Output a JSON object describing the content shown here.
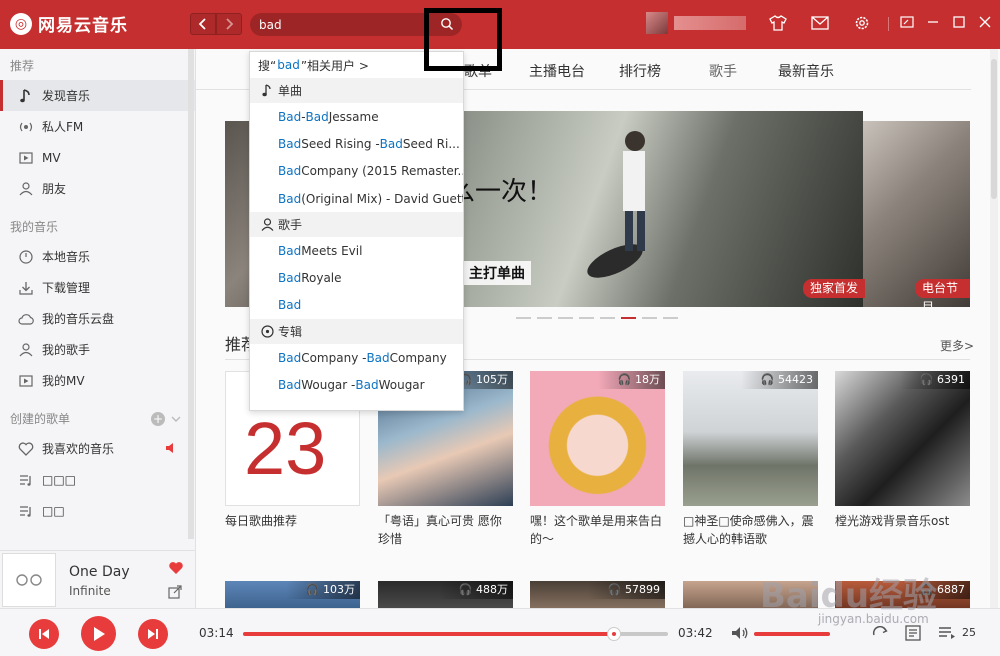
{
  "app": {
    "logo_text": "网易云音乐",
    "accent": "#c62f2f",
    "link_color": "#0c73c2"
  },
  "titlebar": {
    "search_value": "bad",
    "back_icon": "chevron-left-icon",
    "forward_icon": "chevron-right-icon"
  },
  "sidebar": {
    "group_recommend": "推荐",
    "recommend_items": [
      {
        "label": "发现音乐",
        "icon": "music-note-icon"
      },
      {
        "label": "私人FM",
        "icon": "radio-icon"
      },
      {
        "label": "MV",
        "icon": "video-icon"
      },
      {
        "label": "朋友",
        "icon": "friends-icon"
      }
    ],
    "group_my_music": "我的音乐",
    "my_music_items": [
      {
        "label": "本地音乐",
        "icon": "local-music-icon"
      },
      {
        "label": "下载管理",
        "icon": "download-icon"
      },
      {
        "label": "我的音乐云盘",
        "icon": "cloud-icon"
      },
      {
        "label": "我的歌手",
        "icon": "singer-icon"
      },
      {
        "label": "我的MV",
        "icon": "video-icon"
      }
    ],
    "group_playlists": "创建的歌单",
    "playlist_items": [
      {
        "label": "我喜欢的音乐",
        "icon": "heart-icon"
      },
      {
        "label": "□□□",
        "icon": "playlist-icon"
      },
      {
        "label": "□□",
        "icon": "playlist-icon"
      }
    ]
  },
  "now_playing": {
    "title": "One Day",
    "artist": "Infinite"
  },
  "tabs": [
    {
      "label": "歌单"
    },
    {
      "label": "主播电台"
    },
    {
      "label": "排行榜"
    },
    {
      "label": "歌手"
    },
    {
      "label": "最新音乐"
    }
  ],
  "banner": {
    "text_main": "么一次！",
    "text_sub": "主打单曲",
    "tag_exclusive": "独家首发",
    "tag_radio": "电台节目",
    "dots_total": 8,
    "dots_active_index": 5
  },
  "recommend": {
    "title": "推荐",
    "more": "更多>",
    "cards": [
      {
        "title": "每日歌曲推荐",
        "count": "",
        "daily_number": "23"
      },
      {
        "title": "「粤语」真心可贵 愿你珍惜",
        "count": "105万"
      },
      {
        "title": "嘿！这个歌单是用来告白的～",
        "count": "18万"
      },
      {
        "title": "□神圣□使命感佛入，震撼人心的韩语歌",
        "count": "54423"
      },
      {
        "title": "樘光游戏背景音乐ost",
        "count": "6391"
      }
    ],
    "second_row_counts": [
      "103万",
      "488万",
      "57899",
      "",
      "6887"
    ]
  },
  "dropdown": {
    "user_prefix": "搜“",
    "user_keyword": "bad",
    "user_suffix": "”相关用户 >",
    "cat_songs": "单曲",
    "songs": [
      {
        "kw1": "Bad",
        "sep": " - ",
        "kw2": "Bad",
        "rest": " Jessame"
      },
      {
        "kw1": "Bad",
        "sep": " Seed Rising - ",
        "kw2": "Bad",
        "rest": " Seed Ri..."
      },
      {
        "kw1": "Bad",
        "sep": " Company (2015 Remaster...",
        "kw2": "",
        "rest": ""
      },
      {
        "kw1": "Bad",
        "sep": " (Original Mix) - David Guetta...",
        "kw2": "",
        "rest": ""
      }
    ],
    "cat_artists": "歌手",
    "artists": [
      {
        "kw1": "Bad",
        "rest": " Meets Evil"
      },
      {
        "kw1": "Bad",
        "rest": " Royale"
      },
      {
        "kw1": "Bad",
        "rest": ""
      }
    ],
    "cat_albums": "专辑",
    "albums": [
      {
        "kw1": "Bad",
        "sep": " Company - ",
        "kw2": "Bad",
        "rest": " Company"
      },
      {
        "kw1": "Bad",
        "sep": " Wougar - ",
        "kw2": "Bad",
        "rest": " Wougar"
      }
    ]
  },
  "player": {
    "elapsed": "03:14",
    "duration": "03:42",
    "progress_fraction": 0.874,
    "volume_fraction": 1.0,
    "queue_count": "25"
  },
  "watermark": {
    "main": "Baidu经验",
    "sub": "jingyan.baidu.com"
  }
}
